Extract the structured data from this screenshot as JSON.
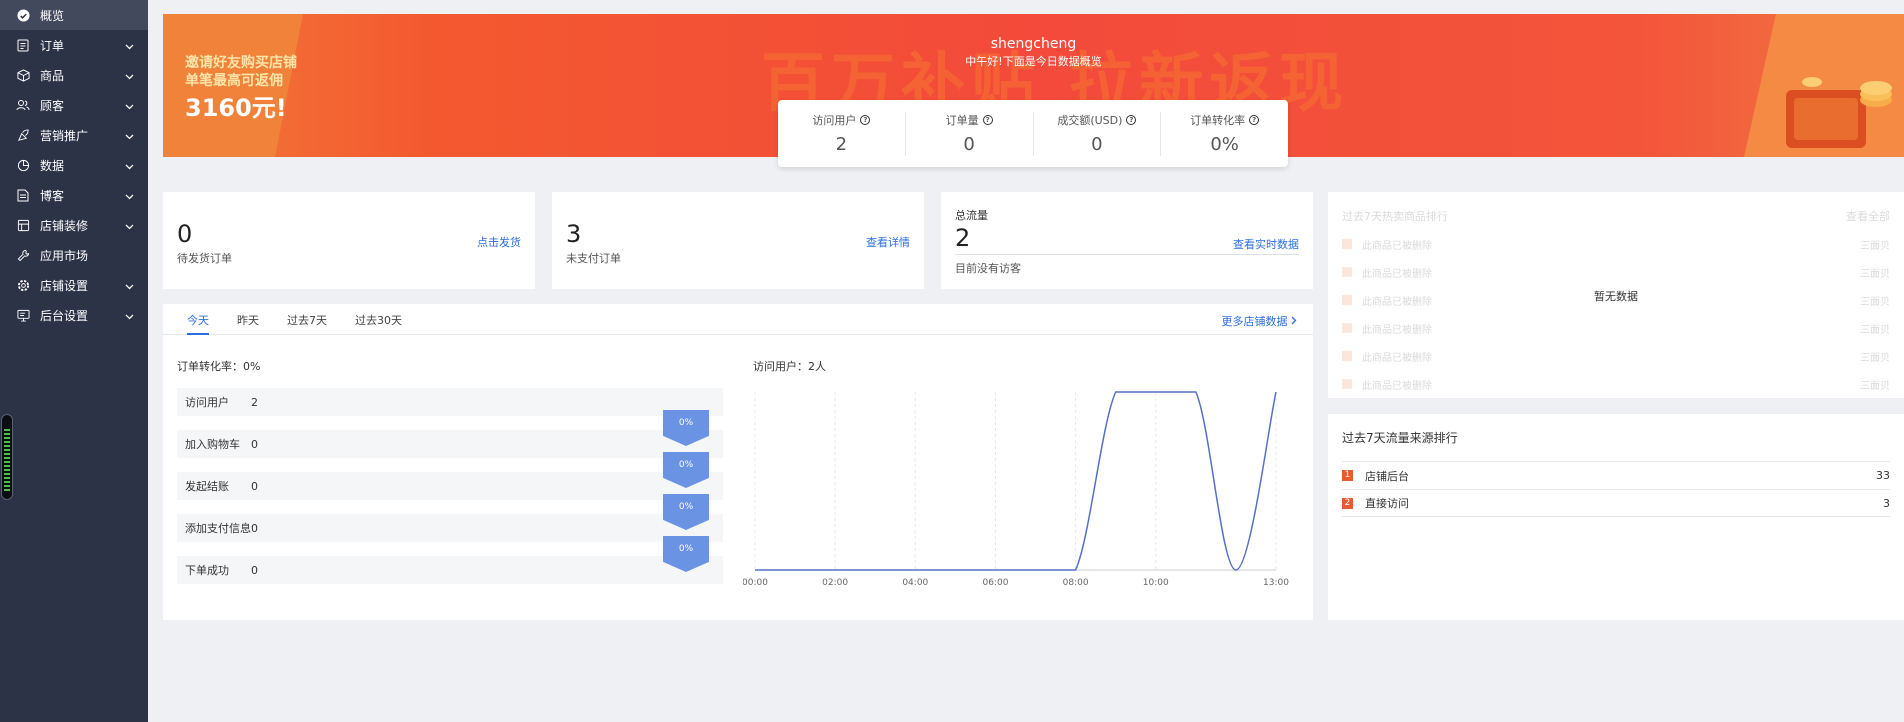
{
  "sidebar": {
    "items": [
      {
        "label": "概览",
        "icon": "dashboard-icon",
        "active": true,
        "expandable": false
      },
      {
        "label": "订单",
        "icon": "order-icon",
        "active": false,
        "expandable": true
      },
      {
        "label": "商品",
        "icon": "product-icon",
        "active": false,
        "expandable": true
      },
      {
        "label": "顾客",
        "icon": "customers-icon",
        "active": false,
        "expandable": true
      },
      {
        "label": "营销推广",
        "icon": "marketing-icon",
        "active": false,
        "expandable": true
      },
      {
        "label": "数据",
        "icon": "pie-chart-icon",
        "active": false,
        "expandable": true
      },
      {
        "label": "博客",
        "icon": "blog-icon",
        "active": false,
        "expandable": true
      },
      {
        "label": "店铺装修",
        "icon": "store-decoration-icon",
        "active": false,
        "expandable": true
      },
      {
        "label": "应用市场",
        "icon": "wrench-icon",
        "active": false,
        "expandable": false
      },
      {
        "label": "店铺设置",
        "icon": "gear-icon",
        "active": false,
        "expandable": true
      },
      {
        "label": "后台设置",
        "icon": "monitor-icon",
        "active": false,
        "expandable": true
      }
    ]
  },
  "banner": {
    "promo_line1": "邀请好友购买店铺",
    "promo_line2": "单笔最高可返佣",
    "promo_amount": "3160元!",
    "headline": "百万补贴 拉新返现",
    "username": "shengcheng",
    "greeting": "中午好!下面是今日数据概览"
  },
  "stats": [
    {
      "label": "访问用户",
      "value": "2"
    },
    {
      "label": "订单量",
      "value": "0"
    },
    {
      "label": "成交额(USD)",
      "value": "0"
    },
    {
      "label": "订单转化率",
      "value": "0%"
    }
  ],
  "cards": {
    "pending": {
      "value": "0",
      "caption": "待发货订单",
      "link": "点击发货"
    },
    "unpaid": {
      "value": "3",
      "caption": "未支付订单",
      "link": "查看详情"
    },
    "traffic": {
      "title": "总流量",
      "value": "2",
      "caption": "目前没有访客",
      "link": "查看实时数据"
    }
  },
  "panel": {
    "tabs": [
      "今天",
      "昨天",
      "过去7天",
      "过去30天"
    ],
    "active_tab": 0,
    "more_link": "更多店铺数据",
    "funnel_title": "订单转化率：0%",
    "funnel": [
      {
        "label": "访问用户",
        "value": "2"
      },
      {
        "label": "加入购物车",
        "value": "0"
      },
      {
        "label": "发起结账",
        "value": "0"
      },
      {
        "label": "添加支付信息",
        "value": "0"
      },
      {
        "label": "下单成功",
        "value": "0"
      }
    ],
    "funnel_rates": [
      "0%",
      "0%",
      "0%",
      "0%"
    ],
    "chart_title": "访问用户：2人"
  },
  "chart_data": {
    "type": "line",
    "x": [
      "00:00",
      "01:00",
      "02:00",
      "03:00",
      "04:00",
      "05:00",
      "06:00",
      "07:00",
      "08:00",
      "09:00",
      "10:00",
      "11:00",
      "12:00",
      "13:00"
    ],
    "values": [
      0,
      0,
      0,
      0,
      0,
      0,
      0,
      0,
      0,
      1,
      1,
      1,
      0,
      1
    ],
    "x_ticks": [
      "00:00",
      "02:00",
      "04:00",
      "06:00",
      "08:00",
      "10:00",
      "13:00"
    ],
    "ylim": [
      0,
      1
    ],
    "color": "#5470c6",
    "grid": "vertical-dashed"
  },
  "hot_products": {
    "title": "过去7天热卖商品排行",
    "link": "查看全部",
    "placeholder_rows": [
      {
        "rank": "1",
        "name": "此商品已被删除",
        "value": "三面贝"
      },
      {
        "rank": "2",
        "name": "此商品已被删除",
        "value": "三面贝"
      },
      {
        "rank": "3",
        "name": "此商品已被删除",
        "value": "三面贝"
      },
      {
        "rank": "4",
        "name": "此商品已被删除",
        "value": "三面贝"
      },
      {
        "rank": "5",
        "name": "此商品已被删除",
        "value": "三面贝"
      },
      {
        "rank": "6",
        "name": "此商品已被删除",
        "value": "三面贝"
      }
    ],
    "empty_text": "暂无数据"
  },
  "traffic_sources": {
    "title": "过去7天流量来源排行",
    "rows": [
      {
        "rank": "1",
        "name": "店铺后台",
        "value": "33"
      },
      {
        "rank": "2",
        "name": "直接访问",
        "value": "3"
      }
    ]
  },
  "colors": {
    "sidebar": "#2c3347",
    "accent": "#2d6fe0",
    "banner": "#f34a3b",
    "rank": "#e85a30",
    "funnel_badge": "#6b93e3"
  }
}
